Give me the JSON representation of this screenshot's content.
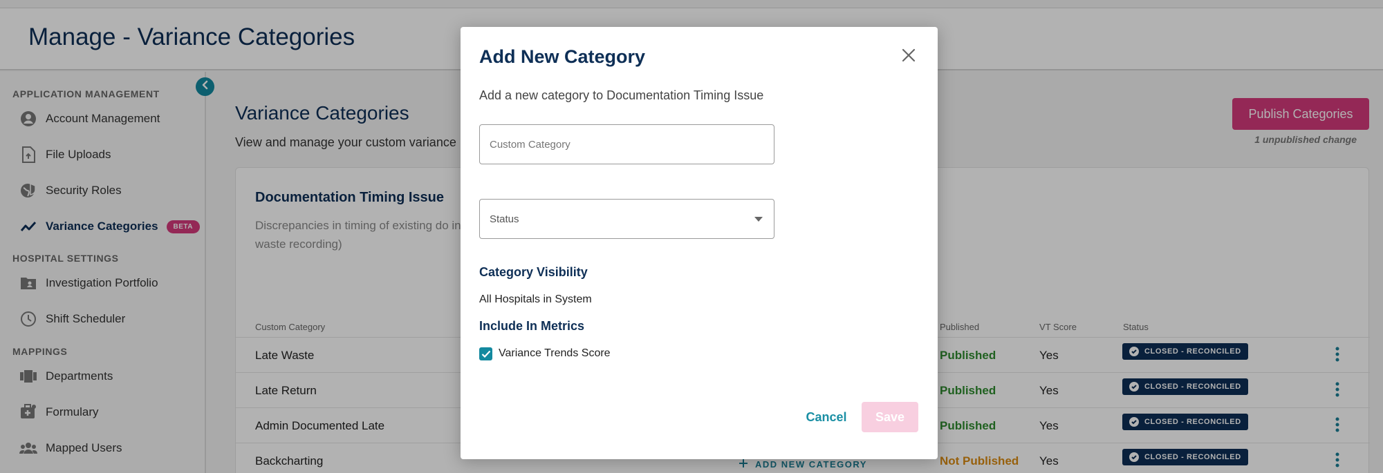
{
  "header": {
    "title": "Manage - Variance Categories"
  },
  "sidebar": {
    "sections": [
      {
        "label": "APPLICATION MANAGEMENT"
      },
      {
        "label": "HOSPITAL SETTINGS"
      },
      {
        "label": "MAPPINGS"
      }
    ],
    "items": [
      {
        "label": "Account Management",
        "icon": "account-circle-icon"
      },
      {
        "label": "File Uploads",
        "icon": "file-upload-icon"
      },
      {
        "label": "Security Roles",
        "icon": "security-globe-icon"
      },
      {
        "label": "Variance Categories",
        "icon": "trend-line-icon",
        "badge": "BETA",
        "active": true
      },
      {
        "label": "Investigation Portfolio",
        "icon": "folder-user-icon"
      },
      {
        "label": "Shift Scheduler",
        "icon": "clock-icon"
      },
      {
        "label": "Departments",
        "icon": "departments-icon"
      },
      {
        "label": "Formulary",
        "icon": "medkit-icon"
      },
      {
        "label": "Mapped Users",
        "icon": "users-icon"
      }
    ]
  },
  "main": {
    "title": "Variance Categories",
    "subtitle": "View and manage your custom variance",
    "publish_button": "Publish Categories",
    "unpublished_note": "1 unpublished change",
    "card": {
      "title": "Documentation Timing Issue",
      "description": "Discrepancies in timing of existing do in waste recording)",
      "columns": {
        "custom_category": "Custom Category",
        "published": "Published",
        "vt_score": "VT Score",
        "status": "Status"
      },
      "rows": [
        {
          "category": "Late Waste",
          "published": "Published",
          "vt_score": "Yes",
          "status": "CLOSED - RECONCILED"
        },
        {
          "category": "Late Return",
          "published": "Published",
          "vt_score": "Yes",
          "status": "CLOSED - RECONCILED"
        },
        {
          "category": "Admin Documented Late",
          "published": "Published",
          "vt_score": "Yes",
          "status": "CLOSED - RECONCILED"
        },
        {
          "category": "Backcharting",
          "published": "Not Published",
          "vt_score": "Yes",
          "status": "CLOSED - RECONCILED"
        }
      ],
      "add_new_label": "ADD NEW CATEGORY"
    }
  },
  "modal": {
    "title": "Add New Category",
    "subtitle": "Add a new category to Documentation Timing Issue",
    "category_placeholder": "Custom Category",
    "status_placeholder": "Status",
    "visibility_heading": "Category Visibility",
    "visibility_value": "All Hospitals in System",
    "metrics_heading": "Include In Metrics",
    "metric_checkbox_label": "Variance Trends Score",
    "metric_checked": true,
    "cancel_label": "Cancel",
    "save_label": "Save"
  },
  "colors": {
    "navy": "#0e2f56",
    "accent_pink": "#d43a7c",
    "teal": "#13899f",
    "published_green": "#2e8b2e",
    "not_published_orange": "#d88a12"
  }
}
